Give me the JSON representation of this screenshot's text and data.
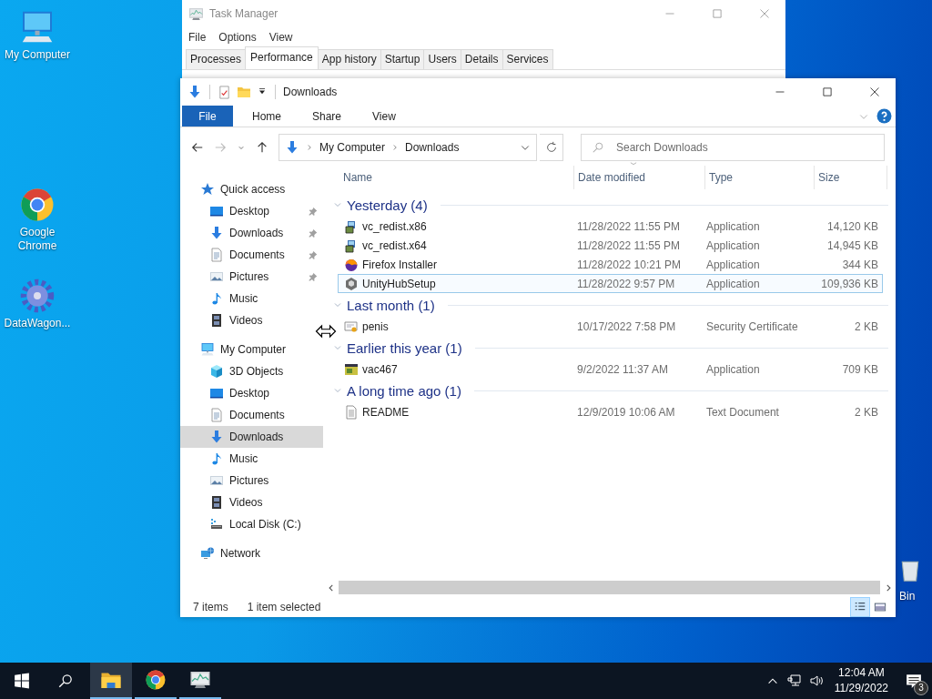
{
  "desktop_icons": [
    {
      "label": "My Computer",
      "kind": "computer"
    },
    {
      "label": "Google Chrome",
      "kind": "chrome"
    },
    {
      "label": "DataWagon...",
      "kind": "gear"
    },
    {
      "label": "Bin",
      "kind": "bin"
    }
  ],
  "task_manager": {
    "title": "Task Manager",
    "menu": [
      "File",
      "Options",
      "View"
    ],
    "tabs": [
      {
        "label": "Processes",
        "selected": false
      },
      {
        "label": "Performance",
        "selected": true
      },
      {
        "label": "App history",
        "selected": false
      },
      {
        "label": "Startup",
        "selected": false
      },
      {
        "label": "Users",
        "selected": false
      },
      {
        "label": "Details",
        "selected": false
      },
      {
        "label": "Services",
        "selected": false
      }
    ]
  },
  "explorer": {
    "title": "Downloads",
    "file_tab": "File",
    "ribbon_tabs": [
      "Home",
      "Share",
      "View"
    ],
    "breadcrumb": [
      "My Computer",
      "Downloads"
    ],
    "search": {
      "placeholder": "Search Downloads"
    },
    "nav": [
      {
        "label": "Quick access",
        "kind": "star",
        "selected": false,
        "children": [
          {
            "label": "Desktop",
            "kind": "desktop",
            "selected": false,
            "pinned": true
          },
          {
            "label": "Downloads",
            "kind": "download",
            "selected": false,
            "pinned": true
          },
          {
            "label": "Documents",
            "kind": "document",
            "selected": false,
            "pinned": true
          },
          {
            "label": "Pictures",
            "kind": "pictures",
            "selected": false,
            "pinned": true
          },
          {
            "label": "Music",
            "kind": "music",
            "selected": false,
            "pinned": false
          },
          {
            "label": "Videos",
            "kind": "video",
            "selected": false,
            "pinned": false
          }
        ]
      },
      {
        "label": "My Computer",
        "kind": "computer",
        "selected": false,
        "children": [
          {
            "label": "3D Objects",
            "kind": "cube",
            "selected": false,
            "pinned": false
          },
          {
            "label": "Desktop",
            "kind": "desktop",
            "selected": false,
            "pinned": false
          },
          {
            "label": "Documents",
            "kind": "document",
            "selected": false,
            "pinned": false
          },
          {
            "label": "Downloads",
            "kind": "download",
            "selected": true,
            "pinned": false
          },
          {
            "label": "Music",
            "kind": "music",
            "selected": false,
            "pinned": false
          },
          {
            "label": "Pictures",
            "kind": "pictures",
            "selected": false,
            "pinned": false
          },
          {
            "label": "Videos",
            "kind": "video",
            "selected": false,
            "pinned": false
          },
          {
            "label": "Local Disk (C:)",
            "kind": "disk",
            "selected": false,
            "pinned": false
          }
        ]
      },
      {
        "label": "Network",
        "kind": "network",
        "selected": false
      }
    ],
    "columns": [
      "Name",
      "Date modified",
      "Type",
      "Size"
    ],
    "groups": [
      {
        "label": "Yesterday (4)",
        "files": [
          {
            "name": "vc_redist.x86",
            "kind": "installer",
            "date": "11/28/2022 11:55 PM",
            "type": "Application",
            "size": "14,120 KB",
            "selected": false
          },
          {
            "name": "vc_redist.x64",
            "kind": "installer",
            "date": "11/28/2022 11:55 PM",
            "type": "Application",
            "size": "14,945 KB",
            "selected": false
          },
          {
            "name": "Firefox Installer",
            "kind": "firefox",
            "date": "11/28/2022 10:21 PM",
            "type": "Application",
            "size": "344 KB",
            "selected": false
          },
          {
            "name": "UnityHubSetup",
            "kind": "unity",
            "date": "11/28/2022 9:57 PM",
            "type": "Application",
            "size": "109,936 KB",
            "selected": true
          }
        ]
      },
      {
        "label": "Last month (1)",
        "files": [
          {
            "name": "penis",
            "kind": "cert",
            "date": "10/17/2022 7:58 PM",
            "type": "Security Certificate",
            "size": "2 KB",
            "selected": false
          }
        ]
      },
      {
        "label": "Earlier this year (1)",
        "files": [
          {
            "name": "vac467",
            "kind": "vac",
            "date": "9/2/2022 11:37 AM",
            "type": "Application",
            "size": "709 KB",
            "selected": false
          }
        ]
      },
      {
        "label": "A long time ago (1)",
        "files": [
          {
            "name": "README",
            "kind": "text",
            "date": "12/9/2019 10:06 AM",
            "type": "Text Document",
            "size": "2 KB",
            "selected": false
          }
        ]
      }
    ],
    "status": {
      "count": "7 items",
      "selection": "1 item selected"
    },
    "view_buttons": [
      {
        "kind": "details",
        "selected": true
      },
      {
        "kind": "tiles",
        "selected": false
      }
    ]
  },
  "taskbar": {
    "apps": [
      {
        "kind": "folder",
        "selected": true
      },
      {
        "kind": "chrome",
        "selected": false
      },
      {
        "kind": "taskmgr",
        "selected": false
      }
    ],
    "time": "12:04 AM",
    "date": "11/29/2022",
    "notifications": "3"
  }
}
